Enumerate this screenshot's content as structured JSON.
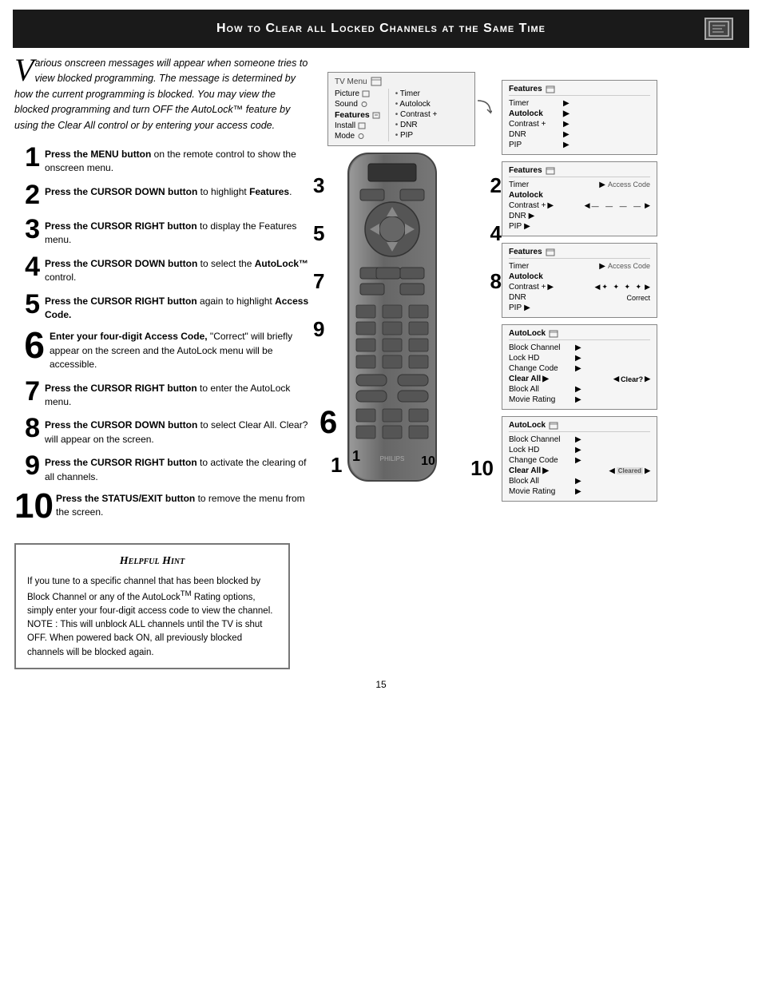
{
  "header": {
    "title": "How to Clear all Locked Channels at the Same Time",
    "icon": "📋"
  },
  "intro": {
    "drop_cap": "V",
    "text": "arious onscreen messages will appear when someone tries to view blocked programming. The message is determined by how the current programming is blocked. You may view the blocked programming and turn OFF the AutoLock™ feature by using the Clear All control or by entering your access code."
  },
  "steps": [
    {
      "num": "1",
      "text": "Press the MENU button on the remote control to show the onscreen menu."
    },
    {
      "num": "2",
      "text": "Press the CURSOR DOWN button to highlight Features."
    },
    {
      "num": "3",
      "text": "Press the CURSOR RIGHT button to display the Features menu."
    },
    {
      "num": "4",
      "text": "Press the CURSOR DOWN button to select the AutoLock™ control."
    },
    {
      "num": "5",
      "text": "Press the CURSOR RIGHT button again to highlight Access Code."
    },
    {
      "num": "6",
      "text": "Enter your four-digit Access Code, \"Correct\" will briefly appear on the screen and the AutoLock menu will be accessible."
    },
    {
      "num": "7",
      "text": "Press the CURSOR RIGHT button to enter the AutoLock menu."
    },
    {
      "num": "8",
      "text": "Press the CURSOR DOWN button to select Clear All.  Clear? will appear on the screen."
    },
    {
      "num": "9",
      "text": "Press the CURSOR RIGHT button to activate the clearing of all channels."
    },
    {
      "num": "10",
      "text": "Press the STATUS/EXIT button to remove the menu from the screen."
    }
  ],
  "tv_menu": {
    "title": "TV Menu",
    "items_left": [
      "Picture",
      "Sound",
      "Features",
      "Install",
      "Mode"
    ],
    "items_right": [
      "Timer",
      "Autolock",
      "Contrast +",
      "DNR",
      "PIP"
    ]
  },
  "screen1": {
    "title": "Features",
    "rows": [
      {
        "label": "Timer",
        "arrow": true,
        "value": ""
      },
      {
        "label": "Autolock",
        "arrow": true,
        "value": "",
        "bold": true
      },
      {
        "label": "Contrast +",
        "arrow": true,
        "value": ""
      },
      {
        "label": "DNR",
        "arrow": true,
        "value": ""
      },
      {
        "label": "PIP",
        "arrow": true,
        "value": ""
      }
    ]
  },
  "screen2": {
    "title": "Features",
    "rows": [
      {
        "label": "Timer",
        "arrow": true,
        "value": "Access Code"
      },
      {
        "label": "Autolock",
        "arrow": false,
        "value": "",
        "bold": true
      },
      {
        "label": "Contrast +",
        "arrow": true,
        "value": "— — — —"
      },
      {
        "label": "DNR",
        "arrow": true,
        "value": ""
      },
      {
        "label": "PIP",
        "arrow": true,
        "value": ""
      }
    ]
  },
  "screen3": {
    "title": "Features",
    "rows": [
      {
        "label": "Timer",
        "arrow": true,
        "value": "Access Code"
      },
      {
        "label": "Autolock",
        "arrow": false,
        "value": "",
        "bold": true
      },
      {
        "label": "Contrast +",
        "arrow": true,
        "value": "* * * *"
      },
      {
        "label": "DNR",
        "arrow": true,
        "value": "Correct"
      },
      {
        "label": "PIP",
        "arrow": true,
        "value": ""
      }
    ]
  },
  "screen4": {
    "title": "AutoLock",
    "rows": [
      {
        "label": "Block Channel",
        "arrow": true,
        "value": ""
      },
      {
        "label": "Lock HD",
        "arrow": true,
        "value": ""
      },
      {
        "label": "Change Code",
        "arrow": true,
        "value": ""
      },
      {
        "label": "Clear All",
        "arrow": true,
        "value": "Clear?",
        "bold": true
      },
      {
        "label": "Block All",
        "arrow": true,
        "value": ""
      },
      {
        "label": "Movie Rating",
        "arrow": true,
        "value": ""
      }
    ]
  },
  "screen5": {
    "title": "AutoLock",
    "rows": [
      {
        "label": "Block Channel",
        "arrow": true,
        "value": ""
      },
      {
        "label": "Lock HD",
        "arrow": true,
        "value": ""
      },
      {
        "label": "Change Code",
        "arrow": true,
        "value": ""
      },
      {
        "label": "Clear All",
        "arrow": true,
        "value": "Cleared",
        "bold": true
      },
      {
        "label": "Block All",
        "arrow": true,
        "value": ""
      },
      {
        "label": "Movie Rating",
        "arrow": true,
        "value": ""
      }
    ]
  },
  "step_overlays": {
    "top_left": [
      "3",
      "5",
      "7",
      "9"
    ],
    "top_right": [
      "2",
      "4",
      "8"
    ],
    "bottom_left": "6",
    "bottom_right": "1",
    "status": "10"
  },
  "hint": {
    "title": "Helpful Hint",
    "text": "If you tune to a specific channel that has been blocked by Block Channel or any of the AutoLock™ Rating options, simply enter your four-digit access code to view the channel.\nNOTE : This will unblock ALL channels until the TV is shut OFF. When powered back ON, all previously blocked channels will be blocked again."
  },
  "page_number": "15",
  "labels": {
    "cursor_right_3": "Press the CURSOR RIGHT button",
    "cursor_right_5": "Press the CURSOR RIGHT button"
  }
}
